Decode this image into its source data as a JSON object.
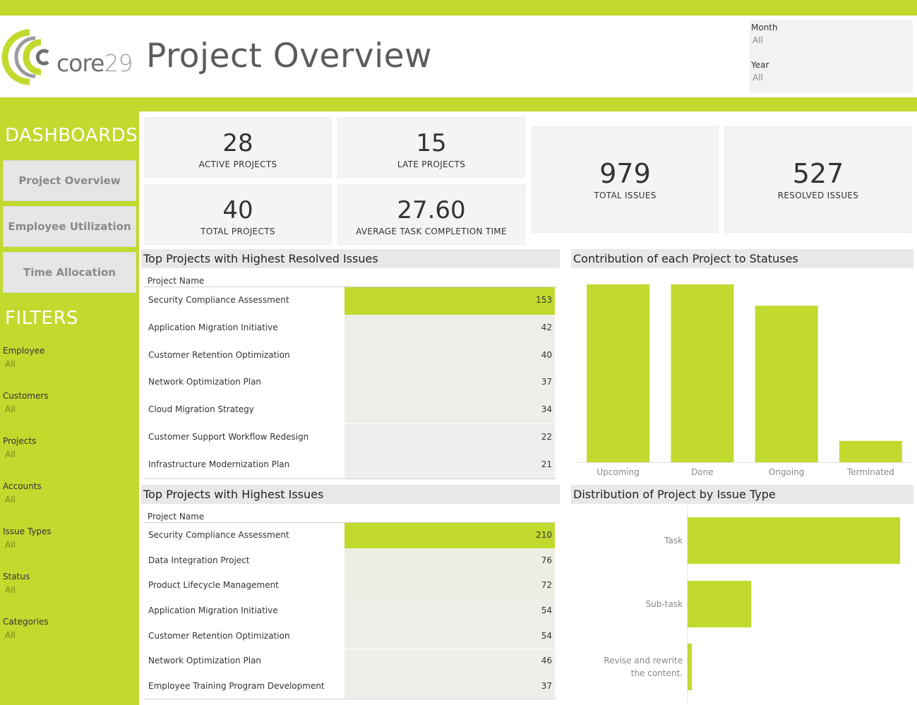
{
  "header": {
    "logo_text_a": "core",
    "logo_text_b": "29",
    "title": "Project Overview",
    "month_label": "Month",
    "month_value": "All",
    "year_label": "Year",
    "year_value": "All"
  },
  "sidebar": {
    "dashboards_heading": "DASHBOARDS",
    "nav": [
      "Project Overview",
      "Employee Utilization",
      "Time Allocation"
    ],
    "filters_heading": "FILTERS",
    "filters": [
      {
        "label": "Employee",
        "value": "All"
      },
      {
        "label": "Customers",
        "value": "All"
      },
      {
        "label": "Projects",
        "value": "All"
      },
      {
        "label": "Accounts",
        "value": "All"
      },
      {
        "label": "Issue Types",
        "value": "All"
      },
      {
        "label": "Status",
        "value": "All"
      },
      {
        "label": "Categories",
        "value": "All"
      }
    ]
  },
  "kpis": {
    "active_projects": {
      "value": "28",
      "label": "ACTIVE PROJECTS"
    },
    "late_projects": {
      "value": "15",
      "label": "LATE PROJECTS"
    },
    "total_projects": {
      "value": "40",
      "label": "TOTAL PROJECTS"
    },
    "avg_task_time": {
      "value": "27.60",
      "label": "AVERAGE TASK COMPLETION TIME"
    },
    "total_issues": {
      "value": "979",
      "label": "TOTAL ISSUES"
    },
    "resolved_issues": {
      "value": "527",
      "label": "RESOLVED ISSUES"
    }
  },
  "resolved_table": {
    "title": "Top Projects with Highest Resolved Issues",
    "column": "Project Name",
    "rows": [
      {
        "name": "Security Compliance Assessment",
        "value": "153"
      },
      {
        "name": "Application Migration Initiative",
        "value": "42"
      },
      {
        "name": "Customer Retention Optimization",
        "value": "40"
      },
      {
        "name": "Network Optimization Plan",
        "value": "37"
      },
      {
        "name": "Cloud Migration Strategy",
        "value": "34"
      },
      {
        "name": "Customer Support Workflow Redesign",
        "value": "22"
      },
      {
        "name": "Infrastructure Modernization Plan",
        "value": "21"
      }
    ]
  },
  "issues_table": {
    "title": "Top Projects with Highest Issues",
    "column": "Project Name",
    "rows": [
      {
        "name": "Security Compliance Assessment",
        "value": "210"
      },
      {
        "name": "Data Integration Project",
        "value": "76"
      },
      {
        "name": "Product Lifecycle Management",
        "value": "72"
      },
      {
        "name": "Application Migration Initiative",
        "value": "54"
      },
      {
        "name": "Customer Retention Optimization",
        "value": "54"
      },
      {
        "name": "Network Optimization Plan",
        "value": "46"
      },
      {
        "name": "Employee Training Program Development",
        "value": "37"
      }
    ]
  },
  "colors": {
    "accent": "#c2d92e",
    "panel": "#f4f4f4",
    "header_strip": "#e8e8e8"
  },
  "chart_data": [
    {
      "type": "bar",
      "title": "Contribution of each Project to Statuses",
      "categories": [
        "Upcoming",
        "Done",
        "Ongoing",
        "Terminated"
      ],
      "values": [
        100,
        100,
        88,
        12
      ],
      "ylim": [
        0,
        100
      ],
      "grid": false
    },
    {
      "type": "bar",
      "orientation": "horizontal",
      "title": "Distribution of Project by Issue Type",
      "categories": [
        "Task",
        "Sub-task",
        "Revise and rewrite the content."
      ],
      "values": [
        100,
        30,
        2
      ],
      "xlim": [
        0,
        100
      ],
      "grid": false
    }
  ]
}
